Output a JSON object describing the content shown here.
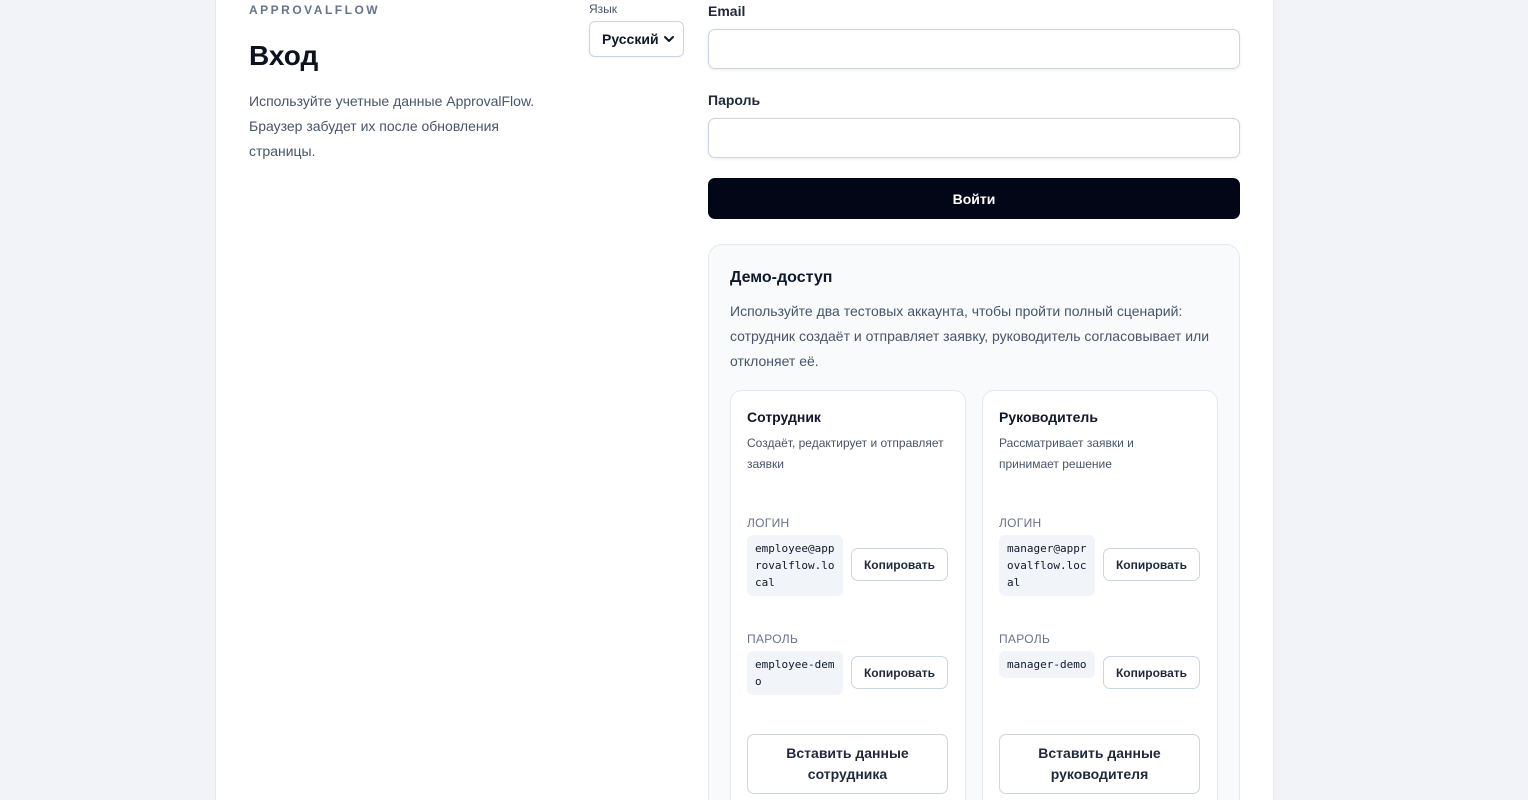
{
  "brand": "APPROVALFLOW",
  "title": "Вход",
  "intro": "Используйте учетные данные ApprovalFlow. Браузер забудет их после обновления страницы.",
  "language": {
    "label": "Язык",
    "selected": "Русский",
    "icon": "chevron-down-icon"
  },
  "form": {
    "email_label": "Email",
    "email_value": "",
    "password_label": "Пароль",
    "password_value": "",
    "submit_label": "Войти"
  },
  "demo": {
    "title": "Демо-доступ",
    "description": "Используйте два тестовых аккаунта, чтобы пройти полный сценарий: сотрудник создаёт и отправляет заявку, руководитель согласовывает или отклоняет её.",
    "roles": [
      {
        "title": "Сотрудник",
        "description": "Создаёт, редактирует и отправляет заявки",
        "login_caption": "ЛОГИН",
        "login": "employee@approvalflow.local",
        "password_caption": "ПАРОЛЬ",
        "password": "employee-demo",
        "copy_label": "Копировать",
        "fill_label": "Вставить данные сотрудника"
      },
      {
        "title": "Руководитель",
        "description": "Рассматривает заявки и принимает решение",
        "login_caption": "ЛОГИН",
        "login": "manager@approvalflow.local",
        "password_caption": "ПАРОЛЬ",
        "password": "manager-demo",
        "copy_label": "Копировать",
        "fill_label": "Вставить данные руководителя"
      }
    ]
  }
}
